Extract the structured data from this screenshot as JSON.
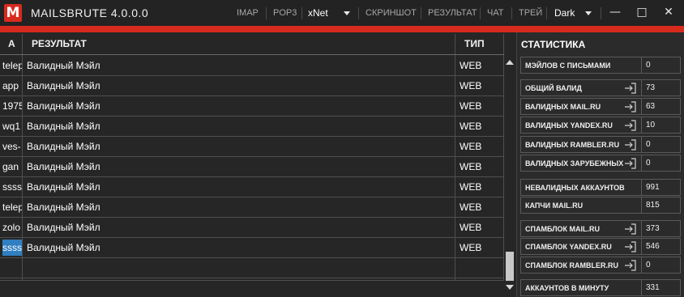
{
  "app": {
    "title": "MAILSBRUTE 4.0.0.0",
    "logo_letter": "M",
    "accent_color": "#d72b1e",
    "selection_color": "#2f7fc1"
  },
  "menu": {
    "imap": "IMAP",
    "pop3": "POP3",
    "xnet": "xNet",
    "screenshot": "СКРИНШОТ",
    "result": "РЕЗУЛЬТАТ",
    "chat": "ЧАТ",
    "tray": "ТРЕЙ",
    "theme": "Dark"
  },
  "window": {
    "minimize": "—",
    "maximize": "□",
    "close": "✕"
  },
  "table": {
    "headers": {
      "a": "A",
      "result": "РЕЗУЛЬТАТ",
      "type": "ТИП"
    },
    "rows": [
      {
        "a": "telep",
        "result": "Валидный Мэйл",
        "type": "WEB"
      },
      {
        "a": "app",
        "result": "Валидный Мэйл",
        "type": "WEB"
      },
      {
        "a": "1975",
        "result": "Валидный Мэйл",
        "type": "WEB"
      },
      {
        "a": "wq1",
        "result": "Валидный Мэйл",
        "type": "WEB"
      },
      {
        "a": "ves-",
        "result": "Валидный Мэйл",
        "type": "WEB"
      },
      {
        "a": "gan",
        "result": "Валидный Мэйл",
        "type": "WEB"
      },
      {
        "a": "ssss",
        "result": "Валидный Мэйл",
        "type": "WEB"
      },
      {
        "a": "telep",
        "result": "Валидный Мэйл",
        "type": "WEB"
      },
      {
        "a": "zolo",
        "result": "Валидный Мэйл",
        "type": "WEB"
      },
      {
        "a": "ssss",
        "result": "Валидный Мэйл",
        "type": "WEB"
      }
    ]
  },
  "stats": {
    "title": "СТАТИСТИКА",
    "items": [
      {
        "label": "МЭЙЛОВ С ПИСЬМАМИ",
        "value": "0",
        "icon": ""
      },
      {
        "label": "ОБЩИЙ ВАЛИД",
        "value": "73",
        "icon": "login-icon"
      },
      {
        "label": "ВАЛИДНЫХ MAIL.RU",
        "value": "63",
        "icon": "login-icon"
      },
      {
        "label": "ВАЛИДНЫХ YANDEX.RU",
        "value": "10",
        "icon": "login-icon"
      },
      {
        "label": "ВАЛИДНЫХ RAMBLER.RU",
        "value": "0",
        "icon": "login-icon"
      },
      {
        "label": "ВАЛИДНЫХ ЗАРУБЕЖНЫХ",
        "value": "0",
        "icon": "login-icon"
      },
      {
        "label": "НЕВАЛИДНЫХ АККАУНТОВ",
        "value": "991",
        "icon": ""
      },
      {
        "label": "КАПЧИ MAIL.RU",
        "value": "815",
        "icon": ""
      },
      {
        "label": "СПАМБЛОК MAIL.RU",
        "value": "373",
        "icon": "login-icon"
      },
      {
        "label": "СПАМБЛОК YANDEX.RU",
        "value": "546",
        "icon": "login-icon"
      },
      {
        "label": "СПАМБЛОК RAMBLER.RU",
        "value": "0",
        "icon": "login-icon"
      },
      {
        "label": "АККАУНТОВ В МИНУТУ",
        "value": "331",
        "icon": ""
      }
    ]
  }
}
